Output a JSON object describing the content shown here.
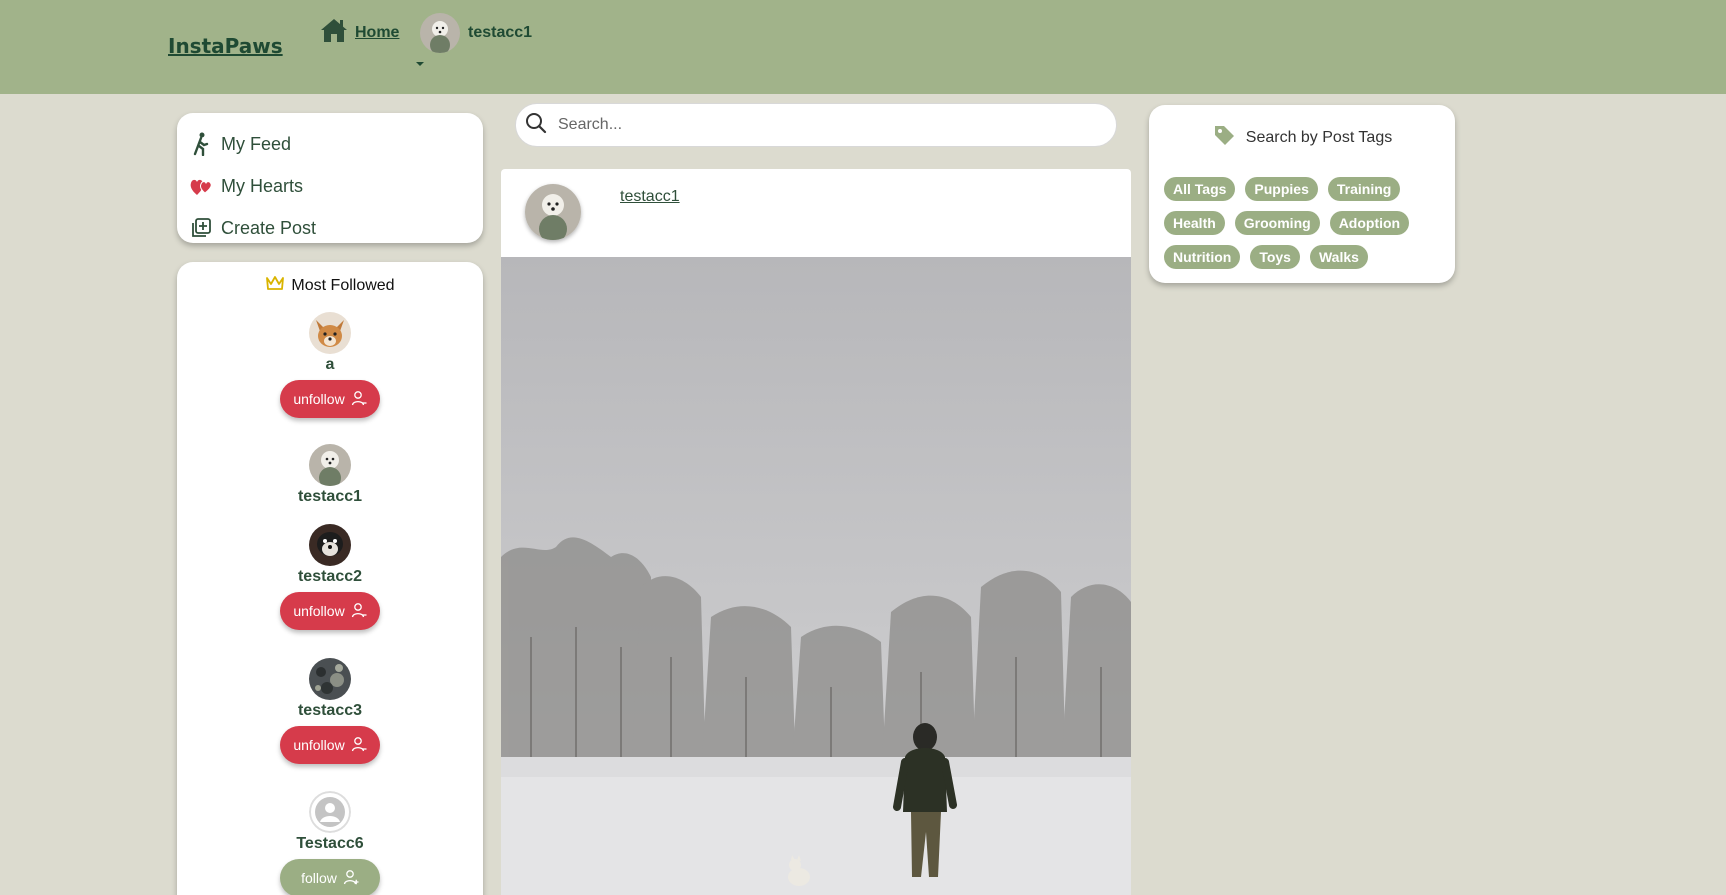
{
  "nav": {
    "brand": "InstaPaws",
    "home_label": "Home",
    "username": "testacc1"
  },
  "menu": {
    "items": [
      {
        "label": "My Feed",
        "icon": "walking-person-icon"
      },
      {
        "label": "My Hearts",
        "icon": "hearts-icon"
      },
      {
        "label": "Create Post",
        "icon": "add-post-icon"
      }
    ]
  },
  "most_followed": {
    "title": "Most Followed",
    "users": [
      {
        "name": "a",
        "button": "unfollow"
      },
      {
        "name": "testacc1",
        "button": ""
      },
      {
        "name": "testacc2",
        "button": "unfollow"
      },
      {
        "name": "testacc3",
        "button": "unfollow"
      },
      {
        "name": "Testacc6",
        "button": "follow"
      }
    ]
  },
  "search": {
    "placeholder": "Search..."
  },
  "post": {
    "author": "testacc1"
  },
  "tags": {
    "title": "Search by Post Tags",
    "items": [
      "All Tags",
      "Puppies",
      "Training",
      "Health",
      "Grooming",
      "Adoption",
      "Nutrition",
      "Toys",
      "Walks"
    ]
  },
  "colors": {
    "header": "#a1b38a",
    "background": "#dcdbcf",
    "unfollow": "#d63b4b",
    "follow": "#9bae84",
    "tag": "#9bae84",
    "text": "#2f4f3a"
  }
}
